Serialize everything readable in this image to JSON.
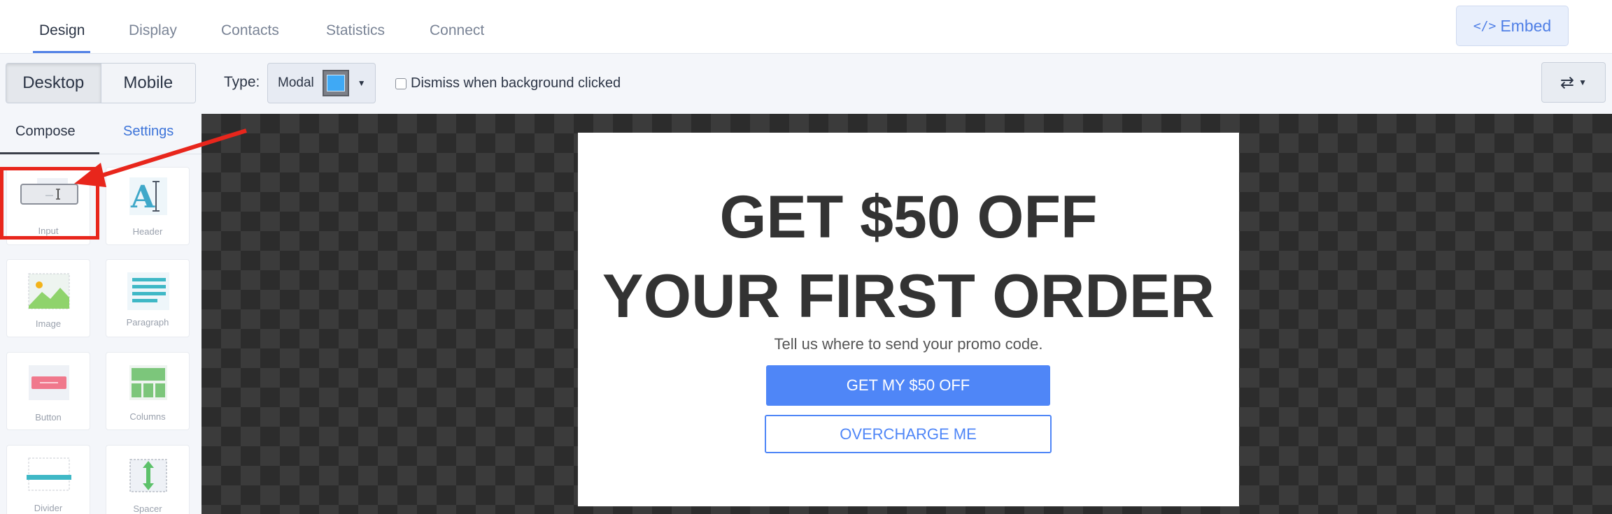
{
  "nav": {
    "tabs": [
      {
        "label": "Design",
        "active": true
      },
      {
        "label": "Display",
        "active": false
      },
      {
        "label": "Contacts",
        "active": false
      },
      {
        "label": "Statistics",
        "active": false
      },
      {
        "label": "Connect",
        "active": false
      }
    ],
    "embed_label": "Embed",
    "embed_icon": "</>"
  },
  "toolbar": {
    "device_options": [
      "Desktop",
      "Mobile"
    ],
    "selected_device": "Desktop",
    "type_label": "Type:",
    "type_value": "Modal",
    "dismiss_label": "Dismiss when background clicked",
    "dismiss_checked": false,
    "swap_icon": "⇄"
  },
  "sidebar": {
    "tabs": [
      "Compose",
      "Settings"
    ],
    "active_tab": "Compose",
    "blocks": [
      {
        "label": "Input",
        "icon": "input-icon"
      },
      {
        "label": "Header",
        "icon": "header-icon"
      },
      {
        "label": "Image",
        "icon": "image-icon"
      },
      {
        "label": "Paragraph",
        "icon": "paragraph-icon"
      },
      {
        "label": "Button",
        "icon": "button-icon"
      },
      {
        "label": "Columns",
        "icon": "columns-icon"
      },
      {
        "label": "Divider",
        "icon": "divider-icon"
      },
      {
        "label": "Spacer",
        "icon": "spacer-icon"
      }
    ]
  },
  "popup": {
    "headline_line1": "GET $50 OFF",
    "headline_line2": "YOUR FIRST ORDER",
    "subtext": "Tell us where to send your promo code.",
    "cta_label": "GET MY $50 OFF",
    "decline_label": "OVERCHARGE ME"
  },
  "colors": {
    "accent": "#4f86f7",
    "annotation": "#e8261c"
  }
}
